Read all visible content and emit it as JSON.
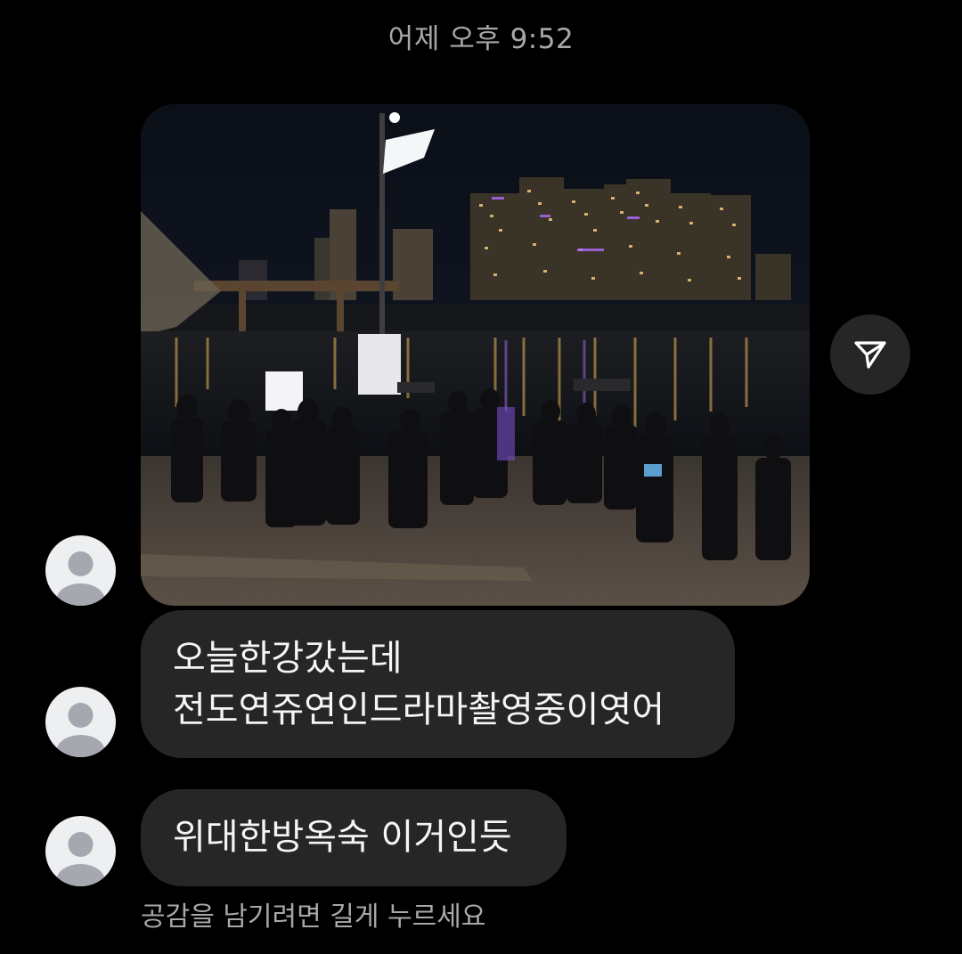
{
  "timestamp": "어제 오후 9:52",
  "messages": [
    {
      "type": "photo",
      "alt_icon": "photo-attachment",
      "share_icon": "send-paper-plane-icon"
    },
    {
      "type": "text",
      "lines": [
        "오늘한강갔는데",
        "전도연쥬연인드라마촬영중이엿어"
      ]
    },
    {
      "type": "text",
      "lines": [
        "위대한방옥숙 이거인듯"
      ]
    }
  ],
  "reaction_hint": "공감을 남기려면 길게 누르세요",
  "avatar_icon": "default-profile-avatar-icon",
  "colors": {
    "background": "#000000",
    "bubble": "#262626",
    "text": "#f5f5f5",
    "muted": "#a8a8a8",
    "avatar_bg": "#eeeff1",
    "avatar_fg": "#a5a8ae"
  }
}
